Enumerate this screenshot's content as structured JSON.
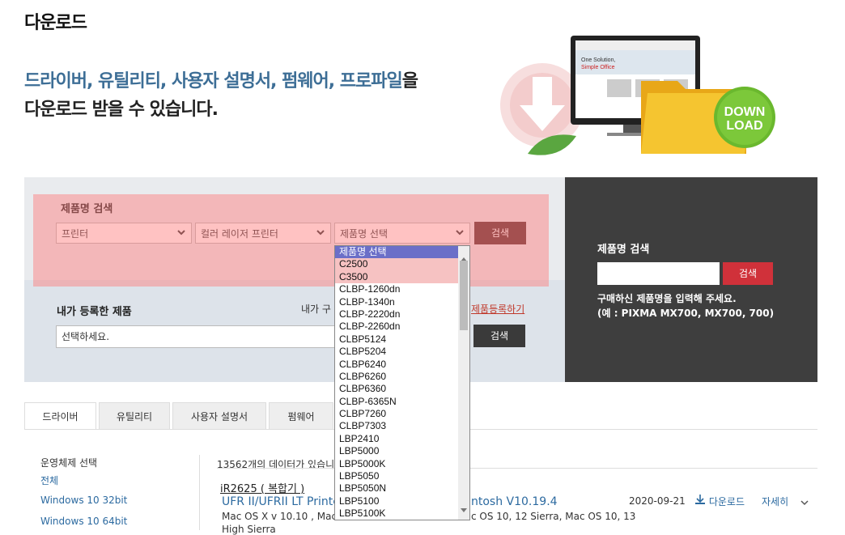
{
  "header": {
    "title": "다운로드",
    "headline_highlight": "드라이버, 유틸리티, 사용자 설명서, 펌웨어, 프로파일",
    "headline_tail": "을",
    "headline_line2": "다운로드 받을 수 있습니다.",
    "banner_badge_line1": "DOWN",
    "banner_badge_line2": "LOAD",
    "banner_screen_text1": "One Solution,",
    "banner_screen_text2": "Simple Office"
  },
  "search": {
    "label": "제품명 검색",
    "category_value": "프린터",
    "subcategory_value": "컬러 레이저 프린터",
    "product_value": "제품명 선택",
    "search_button": "검색"
  },
  "dropdown": {
    "options": [
      "제품명 선택",
      "C2500",
      "C3500",
      "CLBP-1260dn",
      "CLBP-1340n",
      "CLBP-2220dn",
      "CLBP-2260dn",
      "CLBP5124",
      "CLBP5204",
      "CLBP6240",
      "CLBP6260",
      "CLBP6360",
      "CLBP-6365N",
      "CLBP7260",
      "CLBP7303",
      "LBP2410",
      "LBP5000",
      "LBP5000K",
      "LBP5050",
      "LBP5050N",
      "LBP5100",
      "LBP5100K"
    ]
  },
  "registered": {
    "label": "내가 등록한 제품",
    "info_prefix": "내가 구",
    "register_link": "제품등록하기",
    "placeholder_value": "선택하세요.",
    "search_button": "검색"
  },
  "quick_search": {
    "label": "제품명 검색",
    "search_button": "검색",
    "hint_line1": "구매하신 제품명을 입력해 주세요.",
    "hint_line2": "(예 : PIXMA MX700, MX700, 700)"
  },
  "tabs": [
    "드라이버",
    "유틸리티",
    "사용자 설명서",
    "펌웨어"
  ],
  "sidebar": {
    "title": "운영체제 선택",
    "items": [
      "전체",
      "Windows 10 32bit",
      "Windows 10 64bit"
    ]
  },
  "results": {
    "count_text": "13562개의 데이터가 있습니",
    "row": {
      "product": "iR2625 ( 복합기 )",
      "name_left": "UFR II/UFRII LT Printer",
      "name_right": "ntosh V10.19.4",
      "os_left": "Mac OS X v 10.10 , Mac",
      "os_right": "c OS 10, 12 Sierra, Mac OS 10, 13",
      "os_line2": "High Sierra",
      "date": "2020-09-21",
      "download": "다운로드",
      "detail": "자세히"
    }
  }
}
